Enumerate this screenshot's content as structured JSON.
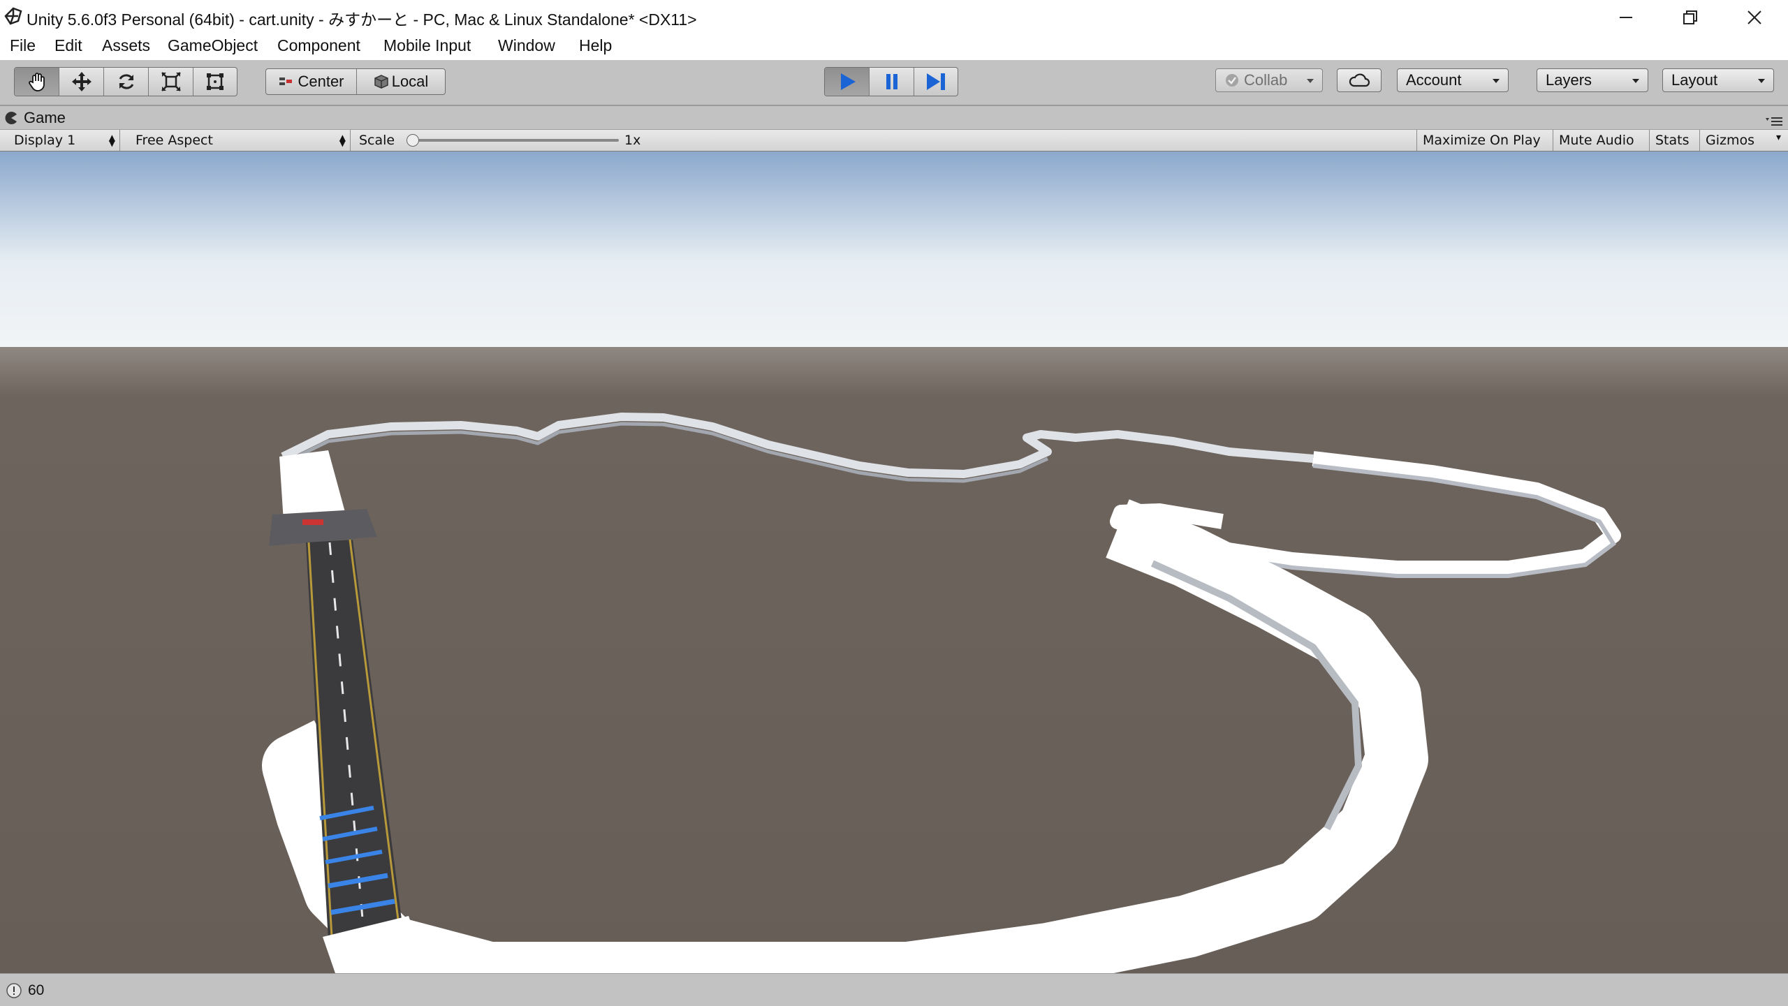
{
  "window": {
    "title": "Unity 5.6.0f3 Personal (64bit) - cart.unity - みすかーと - PC, Mac & Linux Standalone* <DX11>"
  },
  "menu": {
    "items": [
      "File",
      "Edit",
      "Assets",
      "GameObject",
      "Component",
      "Mobile Input",
      "Window",
      "Help"
    ]
  },
  "toolbar": {
    "tools": [
      "hand-tool",
      "move-tool",
      "rotate-tool",
      "scale-tool",
      "rect-tool"
    ],
    "pivot_label": "Center",
    "space_label": "Local",
    "collab_label": "Collab",
    "account_label": "Account",
    "layers_label": "Layers",
    "layout_label": "Layout",
    "play_color": "#1a64d6"
  },
  "game_view": {
    "tab_label": "Game",
    "display": "Display 1",
    "aspect": "Free Aspect",
    "scale_label": "Scale",
    "scale_value": "1x",
    "scale_slider_fraction": 0.0,
    "maximize_label": "Maximize On Play",
    "mute_label": "Mute Audio",
    "stats_label": "Stats",
    "gizmos_label": "Gizmos"
  },
  "scene": {
    "sky_top": "#8ba8cc",
    "sky_horizon": "#f2f4f6",
    "ground": "#6a605a",
    "track": "#ffffff",
    "road": "#3b3b3e",
    "stripe": "#3a84e8"
  },
  "status": {
    "fps": "60"
  }
}
